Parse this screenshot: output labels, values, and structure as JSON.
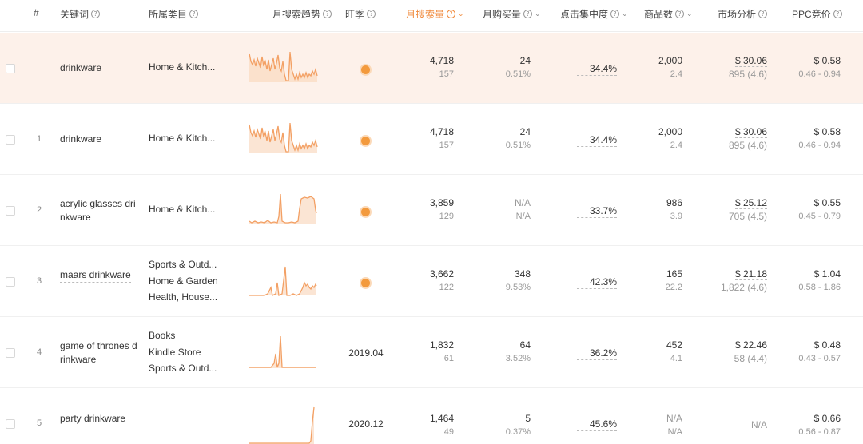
{
  "header": {
    "index": "#",
    "keyword": "关键词",
    "category": "所属类目",
    "trend": "月搜索趋势",
    "season": "旺季",
    "search_volume": "月搜索量",
    "purchase": "月购买量",
    "click_concentration": "点击集中度",
    "product_count": "商品数",
    "market_analysis": "市场分析",
    "ppc": "PPC竞价"
  },
  "accent_color": "#f08a3c",
  "rows": [
    {
      "index": "",
      "keyword": "drinkware",
      "categories": [
        "Home & Kitch..."
      ],
      "season": "dot",
      "search": "4,718",
      "search_sub": "157",
      "purchase": "24",
      "purchase_sub": "0.51%",
      "concentration": "34.4%",
      "products": "2,000",
      "products_sub": "2.4",
      "market": "$ 30.06",
      "market_sub": "895 (4.6)",
      "ppc": "$ 0.58",
      "ppc_sub": "0.46 - 0.94"
    },
    {
      "index": "1",
      "keyword": "drinkware",
      "categories": [
        "Home & Kitch..."
      ],
      "season": "dot",
      "search": "4,718",
      "search_sub": "157",
      "purchase": "24",
      "purchase_sub": "0.51%",
      "concentration": "34.4%",
      "products": "2,000",
      "products_sub": "2.4",
      "market": "$ 30.06",
      "market_sub": "895 (4.6)",
      "ppc": "$ 0.58",
      "ppc_sub": "0.46 - 0.94"
    },
    {
      "index": "2",
      "keyword": "acrylic glasses drinkware",
      "categories": [
        "Home & Kitch..."
      ],
      "season": "dot",
      "search": "3,859",
      "search_sub": "129",
      "purchase": "N/A",
      "purchase_sub": "N/A",
      "concentration": "33.7%",
      "products": "986",
      "products_sub": "3.9",
      "market": "$ 25.12",
      "market_sub": "705 (4.5)",
      "ppc": "$ 0.55",
      "ppc_sub": "0.45 - 0.79"
    },
    {
      "index": "3",
      "keyword": "maars drinkware",
      "categories": [
        "Sports & Outd...",
        "Home & Garden",
        "Health, House..."
      ],
      "season": "dot",
      "search": "3,662",
      "search_sub": "122",
      "purchase": "348",
      "purchase_sub": "9.53%",
      "concentration": "42.3%",
      "products": "165",
      "products_sub": "22.2",
      "market": "$ 21.18",
      "market_sub": "1,822 (4.6)",
      "ppc": "$ 1.04",
      "ppc_sub": "0.58 - 1.86"
    },
    {
      "index": "4",
      "keyword": "game of thrones drinkware",
      "categories": [
        "Books",
        "Kindle Store",
        "Sports & Outd..."
      ],
      "season": "2019.04",
      "search": "1,832",
      "search_sub": "61",
      "purchase": "64",
      "purchase_sub": "3.52%",
      "concentration": "36.2%",
      "products": "452",
      "products_sub": "4.1",
      "market": "$ 22.46",
      "market_sub": "58 (4.4)",
      "ppc": "$ 0.48",
      "ppc_sub": "0.43 - 0.57"
    },
    {
      "index": "5",
      "keyword": "party drinkware",
      "categories": [],
      "season": "2020.12",
      "search": "1,464",
      "search_sub": "49",
      "purchase": "5",
      "purchase_sub": "0.37%",
      "concentration": "45.6%",
      "products": "N/A",
      "products_sub": "N/A",
      "market": "N/A",
      "market_sub": "",
      "ppc": "$ 0.66",
      "ppc_sub": "0.56 - 0.87"
    }
  ]
}
